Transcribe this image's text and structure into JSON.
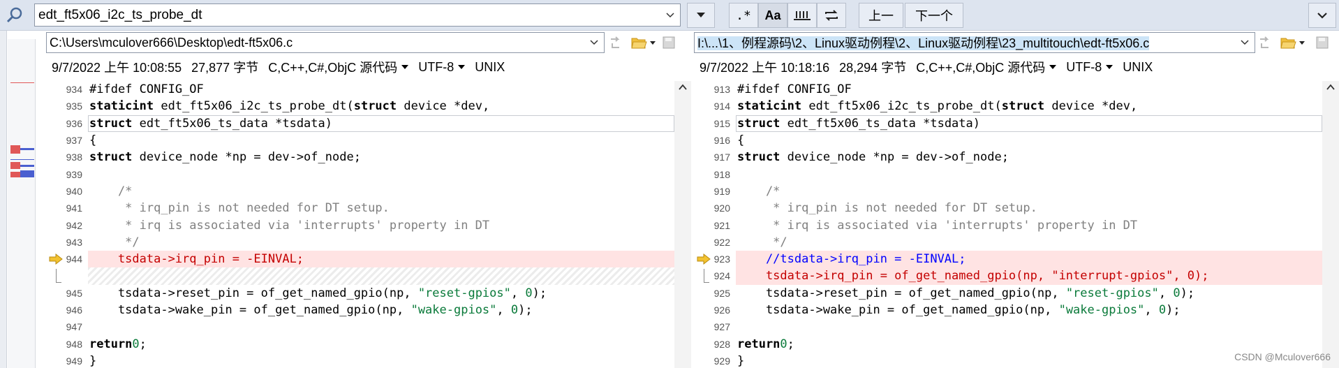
{
  "toolbar": {
    "search_value": "edt_ft5x06_i2c_ts_probe_dt",
    "regex_label": ".*",
    "match_case_label": "Aa",
    "whole_word_label": "abl",
    "prev_label": "上一",
    "next_label": "下一个"
  },
  "left": {
    "path": "C:\\Users\\mculover666\\Desktop\\edt-ft5x06.c",
    "date": "9/7/2022 上午 10:08:55",
    "size": "27,877 字节",
    "language": "C,C++,C#,ObjC 源代码",
    "encoding": "UTF-8",
    "eol": "UNIX",
    "lines": [
      {
        "n": "934",
        "t": "#ifdef CONFIG_OF"
      },
      {
        "n": "935",
        "t": "static int edt_ft5x06_i2c_ts_probe_dt(struct device *dev,"
      },
      {
        "n": "936",
        "t": "                struct edt_ft5x06_ts_data *tsdata)"
      },
      {
        "n": "937",
        "t": "{"
      },
      {
        "n": "938",
        "t": "    struct device_node *np = dev->of_node;"
      },
      {
        "n": "939",
        "t": ""
      },
      {
        "n": "940",
        "t": "    /*"
      },
      {
        "n": "941",
        "t": "     * irq_pin is not needed for DT setup."
      },
      {
        "n": "942",
        "t": "     * irq is associated via 'interrupts' property in DT"
      },
      {
        "n": "943",
        "t": "     */"
      },
      {
        "n": "944",
        "t": "    tsdata->irq_pin = -EINVAL;"
      },
      {
        "n": "",
        "t": ""
      },
      {
        "n": "945",
        "t": "    tsdata->reset_pin = of_get_named_gpio(np, \"reset-gpios\", 0);"
      },
      {
        "n": "946",
        "t": "    tsdata->wake_pin = of_get_named_gpio(np, \"wake-gpios\", 0);"
      },
      {
        "n": "947",
        "t": ""
      },
      {
        "n": "948",
        "t": "    return 0;"
      },
      {
        "n": "949",
        "t": "}"
      }
    ]
  },
  "right": {
    "path": "I:\\...\\1、例程源码\\2、Linux驱动例程\\2、Linux驱动例程\\23_multitouch\\edt-ft5x06.c",
    "date": "9/7/2022 上午 10:18:16",
    "size": "28,294 字节",
    "language": "C,C++,C#,ObjC 源代码",
    "encoding": "UTF-8",
    "eol": "UNIX",
    "lines": [
      {
        "n": "913",
        "t": "#ifdef CONFIG_OF"
      },
      {
        "n": "914",
        "t": "static int edt_ft5x06_i2c_ts_probe_dt(struct device *dev,"
      },
      {
        "n": "915",
        "t": "                struct edt_ft5x06_ts_data *tsdata)"
      },
      {
        "n": "916",
        "t": "{"
      },
      {
        "n": "917",
        "t": "    struct device_node *np = dev->of_node;"
      },
      {
        "n": "918",
        "t": ""
      },
      {
        "n": "919",
        "t": "    /*"
      },
      {
        "n": "920",
        "t": "     * irq_pin is not needed for DT setup."
      },
      {
        "n": "921",
        "t": "     * irq is associated via 'interrupts' property in DT"
      },
      {
        "n": "922",
        "t": "     */"
      },
      {
        "n": "923",
        "t": "    //tsdata->irq_pin = -EINVAL;"
      },
      {
        "n": "924",
        "t": "    tsdata->irq_pin = of_get_named_gpio(np, \"interrupt-gpios\", 0);"
      },
      {
        "n": "925",
        "t": "    tsdata->reset_pin = of_get_named_gpio(np, \"reset-gpios\", 0);"
      },
      {
        "n": "926",
        "t": "    tsdata->wake_pin = of_get_named_gpio(np, \"wake-gpios\", 0);"
      },
      {
        "n": "927",
        "t": ""
      },
      {
        "n": "928",
        "t": "    return 0;"
      },
      {
        "n": "929",
        "t": "}"
      }
    ]
  },
  "watermark": "CSDN @Mculover666",
  "colors": {
    "changed_bg": "#ffe3e3",
    "toolbar_bg": "#dde4ef",
    "overview_red": "#e05858",
    "overview_blue": "#4a5fd0"
  }
}
